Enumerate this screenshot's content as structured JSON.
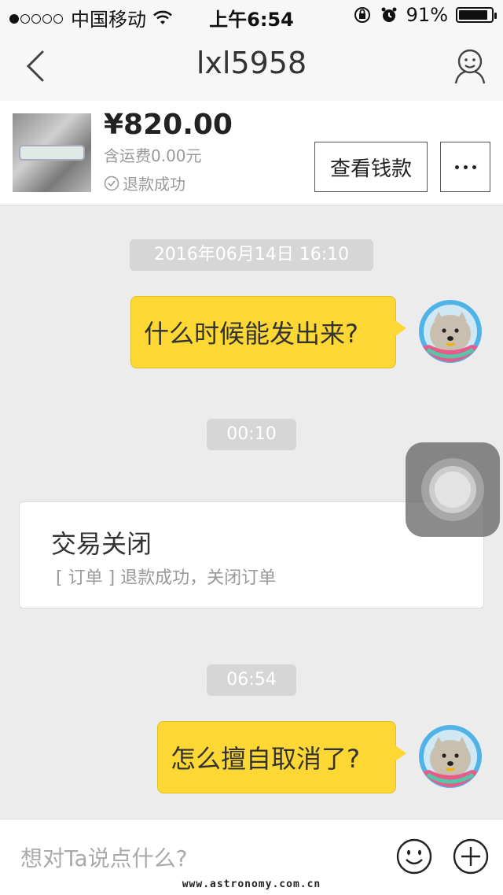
{
  "status_bar": {
    "carrier": "中国移动",
    "time": "上午6:54",
    "battery_percent": "91%",
    "battery_level": 0.91
  },
  "nav": {
    "title": "lxl5958"
  },
  "product": {
    "price": "¥820.00",
    "shipping": "含运费0.00元",
    "refund_status": "退款成功",
    "view_payment_label": "查看钱款"
  },
  "chat": {
    "messages": [
      {
        "type": "timestamp",
        "text": "2016年06月14日 16:10"
      },
      {
        "type": "outgoing",
        "text": "什么时候能发出来?"
      },
      {
        "type": "timestamp",
        "text": "00:10"
      },
      {
        "type": "system",
        "title": "交易关闭",
        "subtitle": "[ 订单 ] 退款成功，关闭订单"
      },
      {
        "type": "timestamp",
        "text": "06:54"
      },
      {
        "type": "outgoing",
        "text": "怎么擅自取消了?"
      }
    ]
  },
  "input": {
    "placeholder": "想对Ta说点什么?"
  },
  "watermark": "www.astronomy.com.cn",
  "colors": {
    "bubble": "#fdd835",
    "background": "#ececec"
  }
}
